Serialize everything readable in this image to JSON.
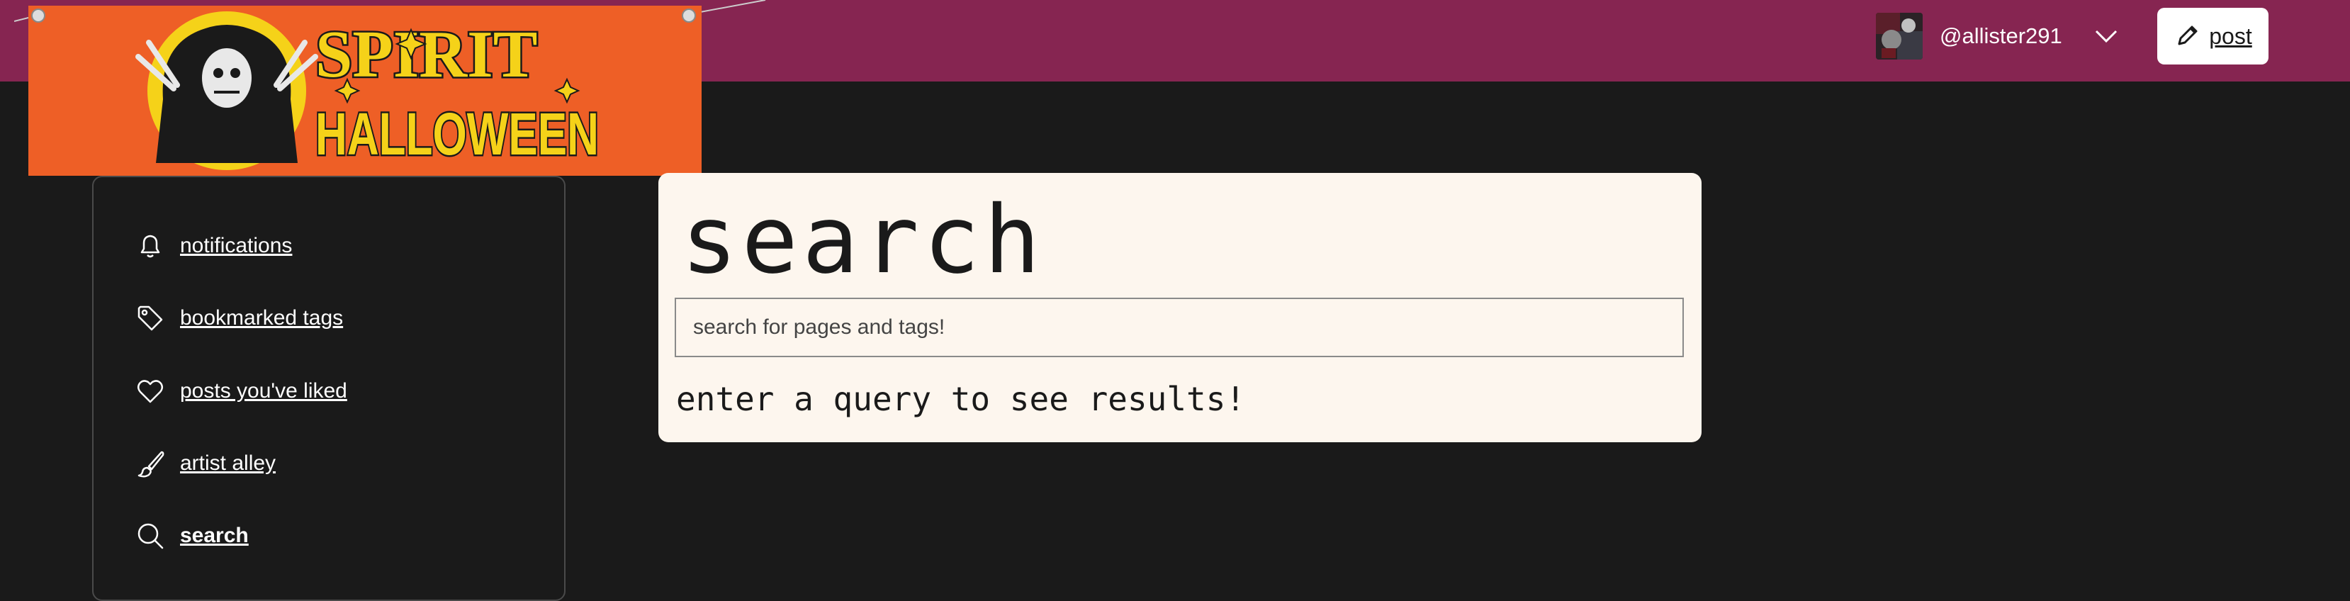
{
  "header": {
    "username": "@allister291",
    "post_label": "post",
    "background_color": "#862551"
  },
  "banner": {
    "line1": "SPIRIT",
    "line2": "HALLOWEEN"
  },
  "sidebar": {
    "items": [
      {
        "label": "notifications",
        "icon": "bell-icon"
      },
      {
        "label": "bookmarked tags",
        "icon": "tag-icon"
      },
      {
        "label": "posts you've liked",
        "icon": "heart-icon"
      },
      {
        "label": "artist alley",
        "icon": "paintbrush-icon"
      },
      {
        "label": "search",
        "icon": "search-icon",
        "active": true
      }
    ]
  },
  "main": {
    "title": "search",
    "search_placeholder": "search for pages and tags!",
    "search_value": "",
    "empty_message": "enter a query to see results!"
  }
}
